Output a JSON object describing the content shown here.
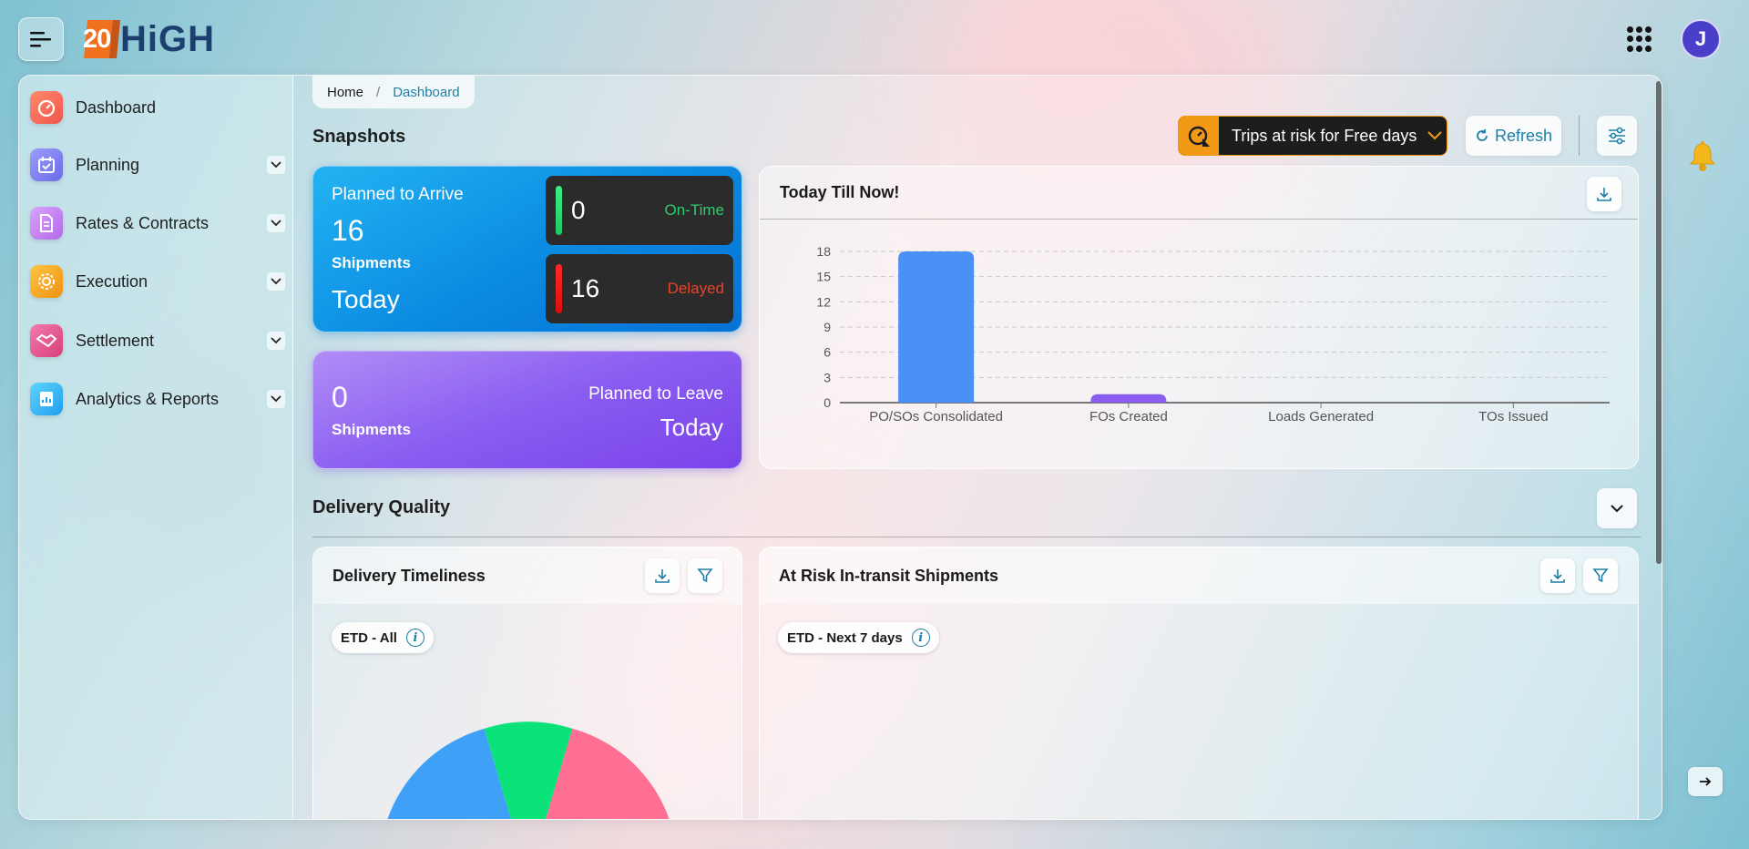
{
  "brand": {
    "logo_number": "20",
    "logo_text": "HiGH"
  },
  "user": {
    "avatar_initial": "J"
  },
  "sidebar": {
    "items": [
      {
        "label": "Dashboard",
        "icon": "speedometer-icon",
        "color": "#f26b5b",
        "has_chevron": false
      },
      {
        "label": "Planning",
        "icon": "calendar-check-icon",
        "color": "#7b7bf0",
        "has_chevron": true
      },
      {
        "label": "Rates & Contracts",
        "icon": "document-icon",
        "color": "#c77ef0",
        "has_chevron": true
      },
      {
        "label": "Execution",
        "icon": "gear-icon",
        "color": "#f2a11d",
        "has_chevron": true
      },
      {
        "label": "Settlement",
        "icon": "handshake-icon",
        "color": "#e8558f",
        "has_chevron": true
      },
      {
        "label": "Analytics & Reports",
        "icon": "report-icon",
        "color": "#33b6f0",
        "has_chevron": true
      }
    ]
  },
  "breadcrumb": {
    "home": "Home",
    "separator": "/",
    "current": "Dashboard"
  },
  "snapshots": {
    "title": "Snapshots",
    "trips_dropdown": "Trips at risk for Free days",
    "refresh_label": "Refresh"
  },
  "arrive_card": {
    "title": "Planned to Arrive",
    "count": "16",
    "unit": "Shipments",
    "period": "Today",
    "on_time": {
      "value": "0",
      "label": "On-Time",
      "color": "#2ecc71"
    },
    "delayed": {
      "value": "16",
      "label": "Delayed",
      "color": "#e8432a"
    }
  },
  "leave_card": {
    "count": "0",
    "unit": "Shipments",
    "title": "Planned to Leave",
    "period": "Today"
  },
  "today_chart": {
    "title": "Today Till Now!",
    "chart_data": {
      "type": "bar",
      "categories": [
        "PO/SOs Consolidated",
        "FOs Created",
        "Loads Generated",
        "TOs Issued"
      ],
      "values": [
        18,
        1,
        0,
        0
      ],
      "colors": [
        "#4a90f5",
        "#8b5cf0",
        "#4a90f5",
        "#4a90f5"
      ],
      "yticks": [
        0,
        3,
        6,
        9,
        12,
        15,
        18
      ],
      "ylim": [
        0,
        18
      ],
      "grid": true
    }
  },
  "delivery_quality": {
    "title": "Delivery Quality",
    "timeliness": {
      "title": "Delivery Timeliness",
      "filter_pill": "ETD - All",
      "donut_colors": [
        "#3ea1f7",
        "#0ce27a",
        "#fe6f93"
      ]
    },
    "at_risk": {
      "title": "At Risk In-transit Shipments",
      "filter_pill": "ETD - Next 7 days"
    }
  }
}
